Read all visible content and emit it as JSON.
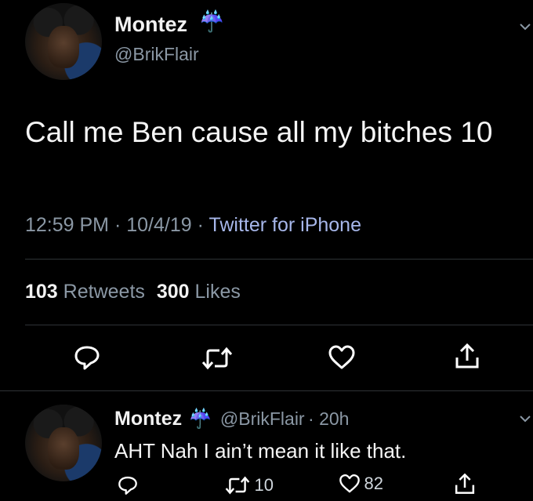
{
  "tweet": {
    "author": {
      "name": "Montez",
      "handle": "@BrikFlair",
      "emoji": "☔"
    },
    "text": "Call me Ben cause all my bitches 10",
    "time": "12:59 PM",
    "date": "10/4/19",
    "sep": "·",
    "source": "Twitter for iPhone",
    "stats": {
      "retweets_count": "103",
      "retweets_label": "Retweets",
      "likes_count": "300",
      "likes_label": "Likes"
    },
    "actions": [
      "reply-icon",
      "retweet-icon",
      "like-icon",
      "share-icon"
    ]
  },
  "reply": {
    "author": {
      "name": "Montez",
      "handle": "@BrikFlair",
      "emoji": "☔"
    },
    "meta": "· 20h",
    "text": "AHT Nah I ain’t mean it like that.",
    "retweets": "10",
    "likes": "82"
  },
  "colors": {
    "background": "#000000",
    "secondary_text": "#8b98a5",
    "source_link": "#a7b7ea",
    "divider": "#2f3336"
  }
}
